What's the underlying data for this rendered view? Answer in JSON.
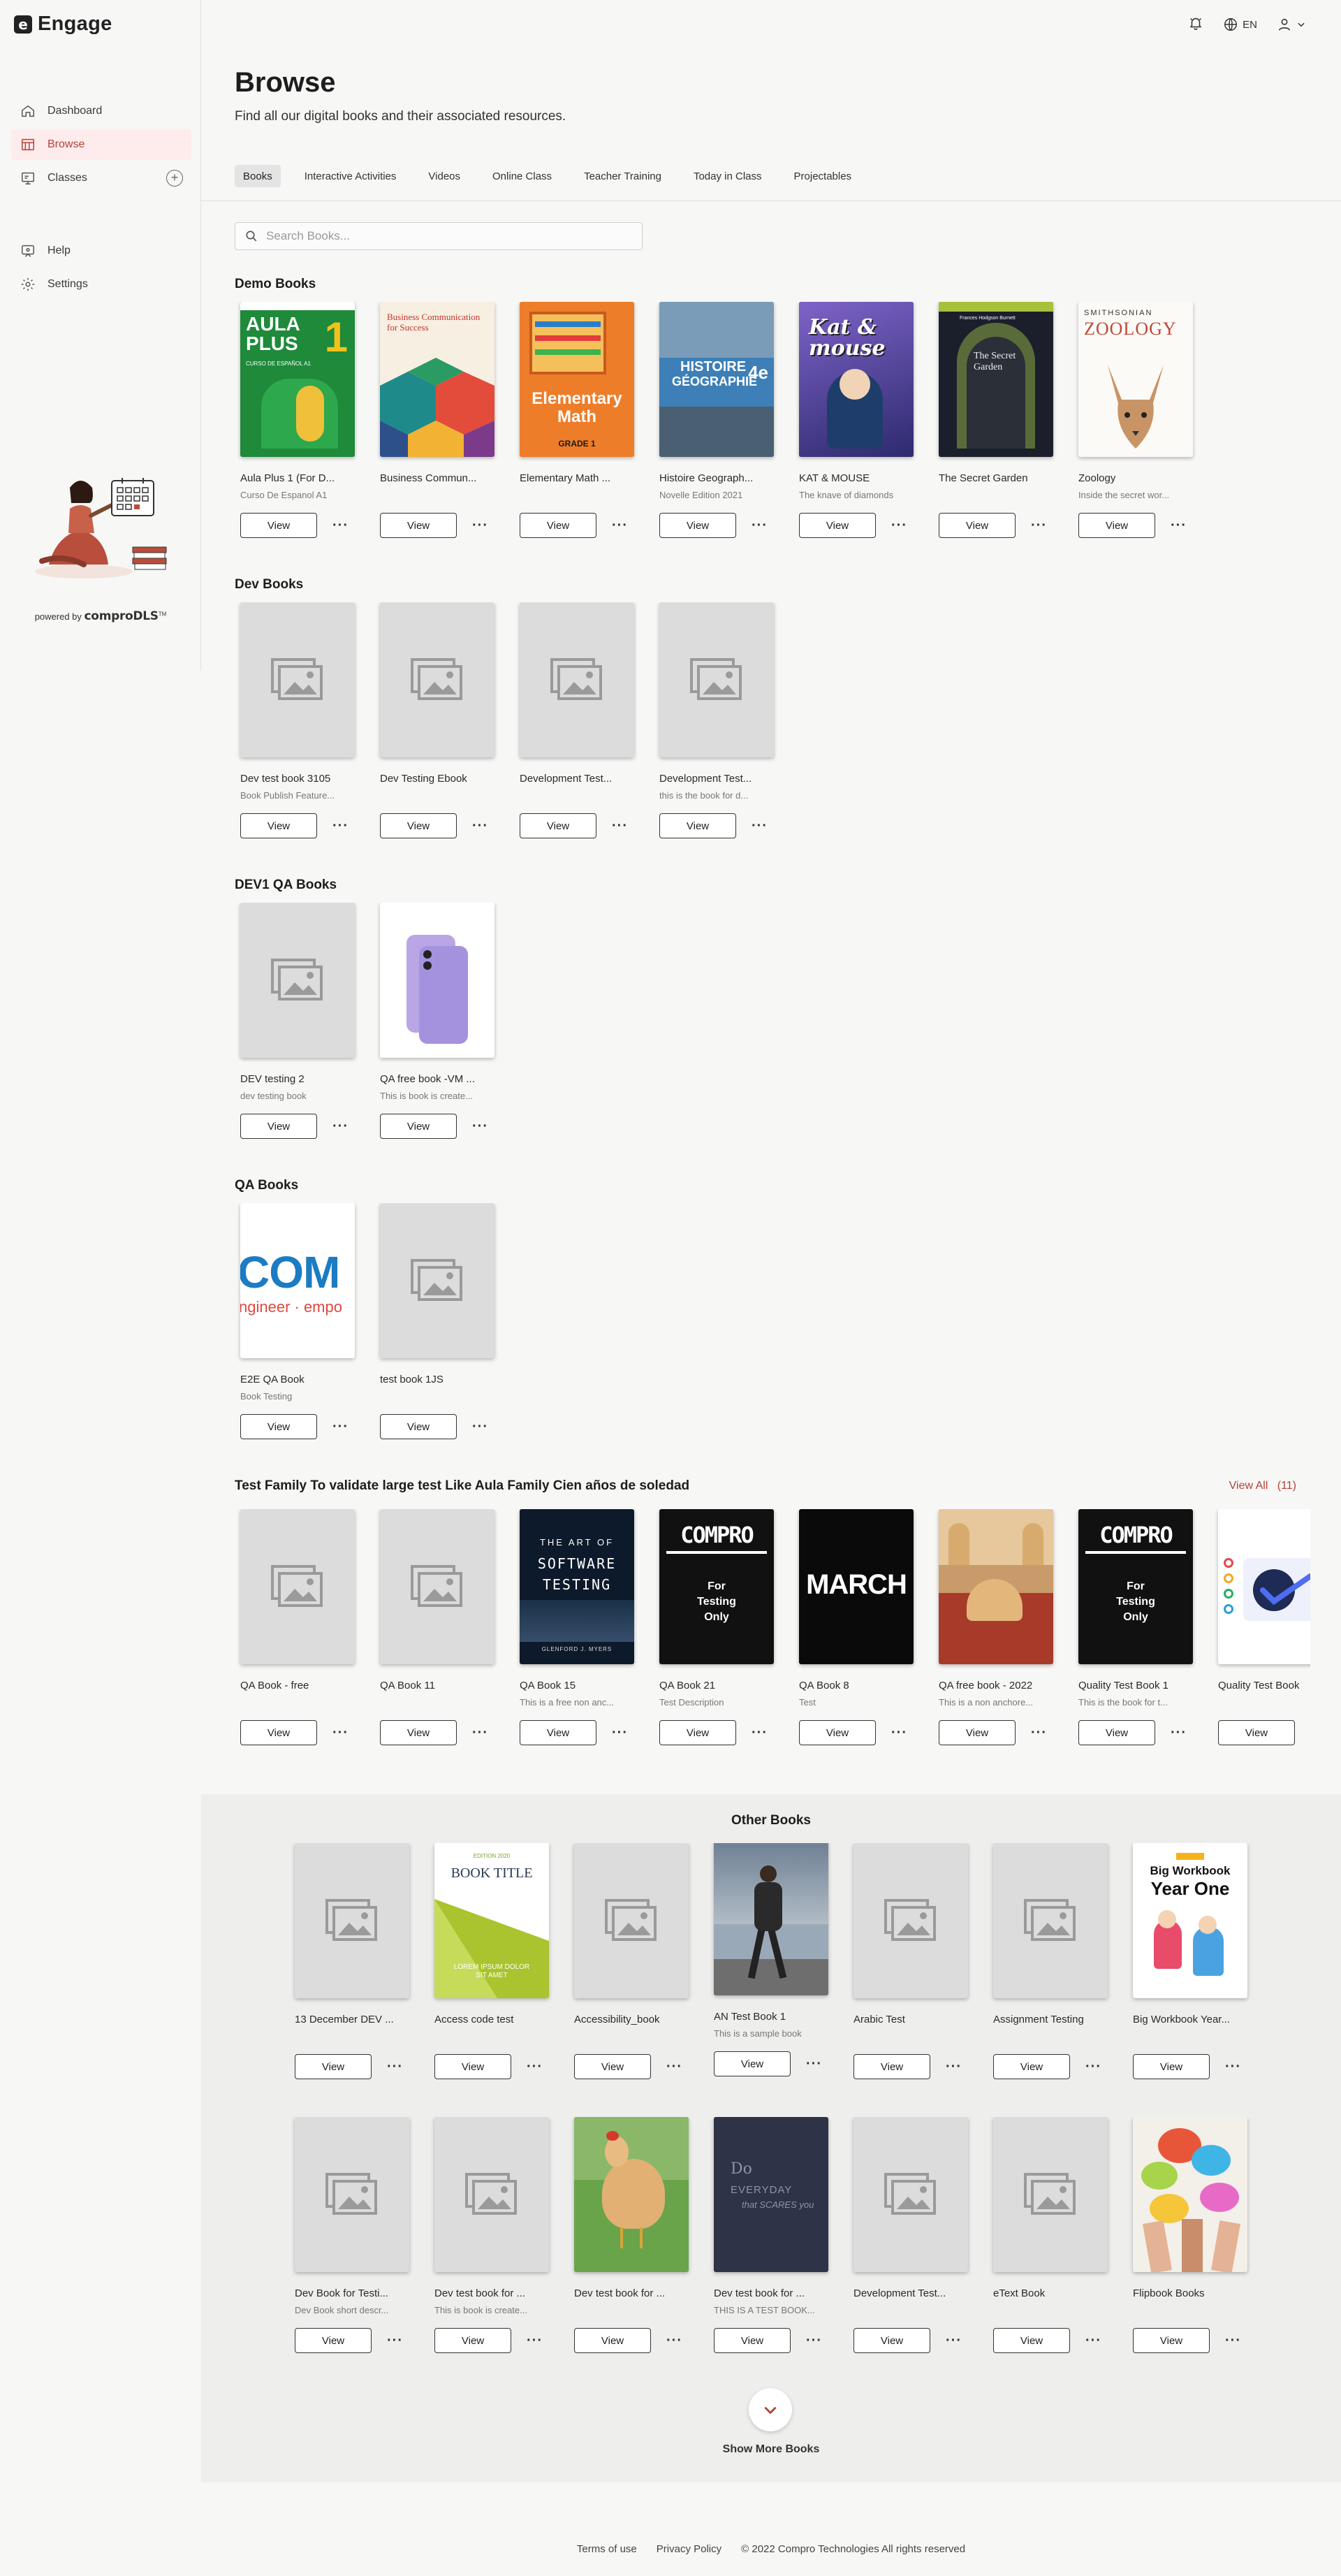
{
  "app": {
    "name": "Engage",
    "logo_letter": "e"
  },
  "topbar": {
    "lang": "EN"
  },
  "sidebar": {
    "items": [
      {
        "label": "Dashboard"
      },
      {
        "label": "Browse"
      },
      {
        "label": "Classes"
      },
      {
        "label": "Help"
      },
      {
        "label": "Settings"
      }
    ],
    "powered_prefix": "powered by",
    "powered_brand": "comproDLS",
    "powered_tm": "TM"
  },
  "page": {
    "title": "Browse",
    "subtitle": "Find all our digital books and their associated resources."
  },
  "tabs": [
    "Books",
    "Interactive Activities",
    "Videos",
    "Online Class",
    "Teacher Training",
    "Today in Class",
    "Projectables"
  ],
  "search": {
    "placeholder": "Search Books..."
  },
  "view_label": "View",
  "sections": [
    {
      "title": "Demo Books",
      "books": [
        {
          "title": "Aula Plus 1 (For D...",
          "desc": "Curso De Espanol A1"
        },
        {
          "title": "Business Commun...",
          "desc": ""
        },
        {
          "title": "Elementary Math ...",
          "desc": ""
        },
        {
          "title": "Histoire Geograph...",
          "desc": "Novelle Edition 2021"
        },
        {
          "title": "KAT & MOUSE",
          "desc": "The knave of diamonds"
        },
        {
          "title": "The Secret Garden",
          "desc": ""
        },
        {
          "title": "Zoology",
          "desc": "Inside the secret wor..."
        }
      ]
    },
    {
      "title": "Dev Books",
      "books": [
        {
          "title": "Dev test book 3105",
          "desc": "Book Publish Feature..."
        },
        {
          "title": "Dev Testing Ebook",
          "desc": ""
        },
        {
          "title": "Development Test...",
          "desc": ""
        },
        {
          "title": "Development Test...",
          "desc": "this is the book for d..."
        }
      ]
    },
    {
      "title": "DEV1 QA Books",
      "books": [
        {
          "title": "DEV testing 2",
          "desc": "dev testing book"
        },
        {
          "title": "QA free book -VM ...",
          "desc": "This is book is create..."
        }
      ]
    },
    {
      "title": "QA Books",
      "books": [
        {
          "title": "E2E QA Book",
          "desc": "Book Testing"
        },
        {
          "title": "test book 1JS",
          "desc": ""
        }
      ]
    },
    {
      "title": "Test Family To validate large test Like Aula Family Cien años de soledad",
      "view_all": "View All",
      "count": "(11)",
      "books": [
        {
          "title": "QA Book - free",
          "desc": ""
        },
        {
          "title": "QA Book 11",
          "desc": ""
        },
        {
          "title": "QA Book 15",
          "desc": "This is a free non anc..."
        },
        {
          "title": "QA Book 21",
          "desc": "Test Description"
        },
        {
          "title": "QA Book 8",
          "desc": "Test"
        },
        {
          "title": "QA free book - 2022",
          "desc": "This is a non anchore..."
        },
        {
          "title": "Quality Test Book 1",
          "desc": "This is the book for t..."
        },
        {
          "title": "Quality Test Book",
          "desc": ""
        }
      ]
    }
  ],
  "cover_text": {
    "aula_big": "AULA PLUS",
    "aula_num": "1",
    "aula_sub": "CURSO DE ESPAÑOL A1",
    "biz": "Business Communication for Success",
    "math1": "Elementary Math",
    "math2": "GRADE 1",
    "hist1": "HISTOIRE",
    "hist2": "GÉOGRAPHIE",
    "hist3": "4e",
    "kat": "Kat & mouse",
    "secret1": "Frances Hodgson Burnett",
    "secret2": "The Secret Garden",
    "zoo1": "SMITHSONIAN",
    "zoo2": "ZOOLOGY",
    "com1": "COM",
    "com2": "ngineer · empo",
    "art1": "THE ART OF",
    "art2": "SOFTWARE",
    "art3": "TESTING",
    "art4": "GLENFORD J. MYERS",
    "compro": "COMPRO",
    "forTesting": "For Testing Only",
    "march": "MARCH",
    "booktitle_top": "EDITION 2020",
    "booktitle": "BOOK TITLE",
    "booktitle_sub": "LOREM IPSUM DOLOR SIT AMET",
    "bigwb1": "Big Workbook",
    "bigwb2": "Year One",
    "do1": "Do",
    "do2": "EVERYDAY",
    "do3": "that SCARES you"
  },
  "other": {
    "title": "Other Books",
    "rows": [
      [
        {
          "title": "13 December DEV ...",
          "desc": ""
        },
        {
          "title": "Access code test",
          "desc": ""
        },
        {
          "title": "Accessibility_book",
          "desc": ""
        },
        {
          "title": "AN Test Book 1",
          "desc": "This is a sample book"
        },
        {
          "title": "Arabic Test",
          "desc": ""
        },
        {
          "title": "Assignment Testing",
          "desc": ""
        },
        {
          "title": "Big Workbook Year...",
          "desc": ""
        }
      ],
      [
        {
          "title": "Dev Book for Testi...",
          "desc": "Dev Book short descr..."
        },
        {
          "title": "Dev test book for ...",
          "desc": "This is book is create..."
        },
        {
          "title": "Dev test book for ...",
          "desc": ""
        },
        {
          "title": "Dev test book for ...",
          "desc": "THIS IS A TEST BOOK..."
        },
        {
          "title": "Development Test...",
          "desc": ""
        },
        {
          "title": "eText Book",
          "desc": ""
        },
        {
          "title": "Flipbook Books",
          "desc": ""
        }
      ]
    ],
    "show_more": "Show More Books"
  },
  "footer": {
    "terms": "Terms of use",
    "privacy": "Privacy Policy",
    "copyright": "© 2022 Compro Technologies All rights reserved"
  },
  "colors": {
    "accent": "#b64037",
    "active_bg": "#fdeceb",
    "placeholder": "#dcdcdc"
  }
}
